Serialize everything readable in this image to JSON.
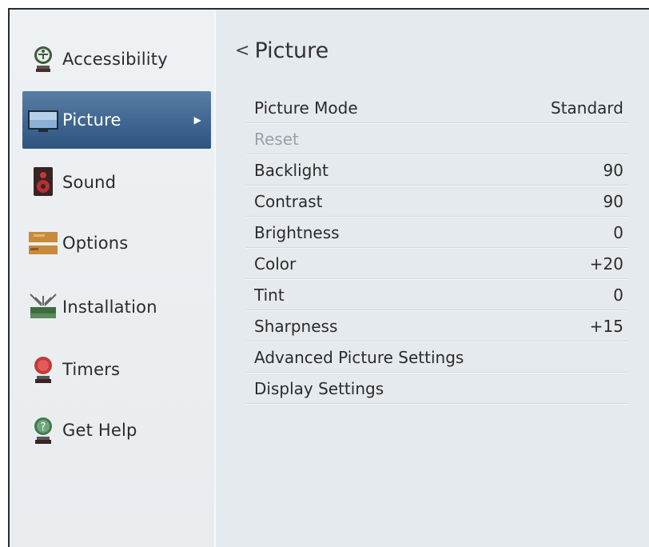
{
  "sidebar": {
    "items": [
      {
        "label": "Accessibility",
        "icon": "accessibility-icon",
        "selected": false
      },
      {
        "label": "Picture",
        "icon": "tv-icon",
        "selected": true
      },
      {
        "label": "Sound",
        "icon": "speaker-icon",
        "selected": false
      },
      {
        "label": "Options",
        "icon": "toolbox-icon",
        "selected": false
      },
      {
        "label": "Installation",
        "icon": "antenna-icon",
        "selected": false
      },
      {
        "label": "Timers",
        "icon": "timer-icon",
        "selected": false
      },
      {
        "label": "Get Help",
        "icon": "help-icon",
        "selected": false
      }
    ],
    "selected_color": "#3f6690"
  },
  "main": {
    "back_glyph": "<",
    "title": "Picture",
    "settings": [
      {
        "label": "Picture Mode",
        "value": "Standard",
        "enabled": true
      },
      {
        "label": "Reset",
        "value": "",
        "enabled": false
      },
      {
        "label": "Backlight",
        "value": "90",
        "enabled": true
      },
      {
        "label": "Contrast",
        "value": "90",
        "enabled": true
      },
      {
        "label": "Brightness",
        "value": "0",
        "enabled": true
      },
      {
        "label": "Color",
        "value": "+20",
        "enabled": true
      },
      {
        "label": "Tint",
        "value": "0",
        "enabled": true
      },
      {
        "label": "Sharpness",
        "value": "+15",
        "enabled": true
      },
      {
        "label": "Advanced Picture Settings",
        "value": "",
        "enabled": true
      },
      {
        "label": "Display Settings",
        "value": "",
        "enabled": true
      }
    ]
  }
}
